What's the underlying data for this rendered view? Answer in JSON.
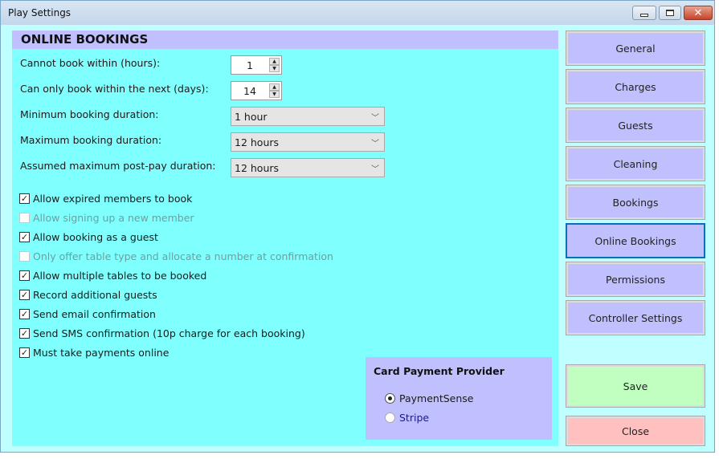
{
  "window": {
    "title": "Play Settings",
    "controls": {
      "minimize": "minimize",
      "maximize": "maximize",
      "close": "✕"
    }
  },
  "section": {
    "title": "ONLINE BOOKINGS"
  },
  "fields": {
    "cannot_book_within": {
      "label": "Cannot book within (hours):",
      "value": "1"
    },
    "book_within_next": {
      "label": "Can only book within the next (days):",
      "value": "14"
    },
    "min_duration": {
      "label": "Minimum booking duration:",
      "value": "1 hour"
    },
    "max_duration": {
      "label": "Maximum booking duration:",
      "value": "12 hours"
    },
    "post_pay_duration": {
      "label": "Assumed maximum post-pay duration:",
      "value": "12 hours"
    }
  },
  "checkboxes": [
    {
      "label": "Allow expired members to book",
      "checked": true,
      "enabled": true
    },
    {
      "label": "Allow signing up a new member",
      "checked": false,
      "enabled": false
    },
    {
      "label": "Allow booking as a guest",
      "checked": true,
      "enabled": true
    },
    {
      "label": "Only offer table type and allocate a number at confirmation",
      "checked": false,
      "enabled": false
    },
    {
      "label": "Allow multiple tables to be booked",
      "checked": true,
      "enabled": true
    },
    {
      "label": "Record additional guests",
      "checked": true,
      "enabled": true
    },
    {
      "label": "Send email confirmation",
      "checked": true,
      "enabled": true
    },
    {
      "label": "Send SMS confirmation (10p charge for each booking)",
      "checked": true,
      "enabled": true
    },
    {
      "label": "Must take payments online",
      "checked": true,
      "enabled": true
    }
  ],
  "payment": {
    "title": "Card Payment Provider",
    "options": [
      {
        "label": "PaymentSense",
        "selected": true
      },
      {
        "label": "Stripe",
        "selected": false
      }
    ]
  },
  "nav": {
    "items": [
      {
        "label": "General"
      },
      {
        "label": "Charges"
      },
      {
        "label": "Guests"
      },
      {
        "label": "Cleaning"
      },
      {
        "label": "Bookings"
      },
      {
        "label": "Online Bookings",
        "active": true
      },
      {
        "label": "Permissions"
      },
      {
        "label": "Controller Settings"
      }
    ]
  },
  "actions": {
    "save": "Save",
    "close": "Close"
  },
  "colors": {
    "panel": "#80ffff",
    "window_bg": "#bfffff",
    "header": "#c0c0ff",
    "save": "#c0ffc0",
    "close": "#ffc0c0",
    "active_border": "#0b6fb8"
  }
}
